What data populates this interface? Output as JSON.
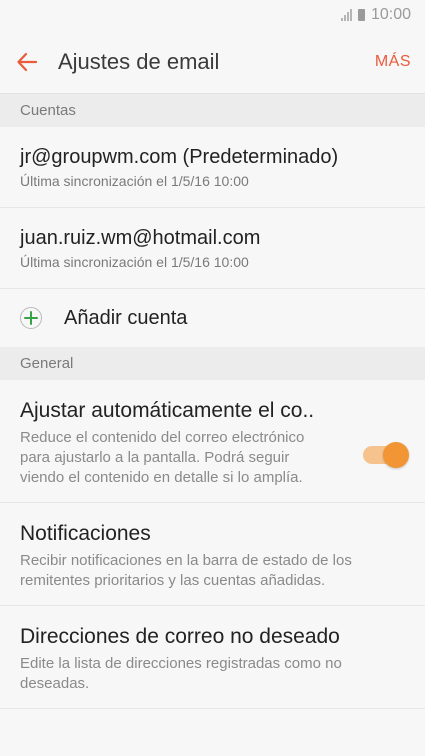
{
  "status_bar": {
    "time": "10:00"
  },
  "app_bar": {
    "title": "Ajustes de email",
    "more_label": "MÁS"
  },
  "sections": {
    "accounts_header": "Cuentas",
    "general_header": "General"
  },
  "accounts": [
    {
      "email": "jr@groupwm.com (Predeterminado)",
      "sync": "Última sincronización el 1/5/16 10:00"
    },
    {
      "email": "juan.ruiz.wm@hotmail.com",
      "sync": "Última sincronización el 1/5/16 10:00"
    }
  ],
  "add_account": {
    "label": "Añadir cuenta"
  },
  "settings": [
    {
      "title": "Ajustar automáticamente el co..",
      "description": "Reduce el contenido del correo electrónico para ajustarlo a la pantalla. Podrá seguir viendo el contenido en detalle si lo amplía.",
      "toggle_on": true
    },
    {
      "title": "Notificaciones",
      "description": "Recibir notificaciones en la barra de estado de los remitentes prioritarios y las cuentas añadidas."
    },
    {
      "title": "Direcciones de correo no deseado",
      "description": "Edite la lista de direcciones registradas como no deseadas."
    }
  ],
  "colors": {
    "accent": "#ea5b3b",
    "toggle": "#f19535",
    "add_icon": "#38a24a"
  },
  "icons": {
    "back": "arrow-left-icon",
    "add": "plus-circle-icon",
    "signal": "signal-icon",
    "battery": "battery-icon"
  }
}
